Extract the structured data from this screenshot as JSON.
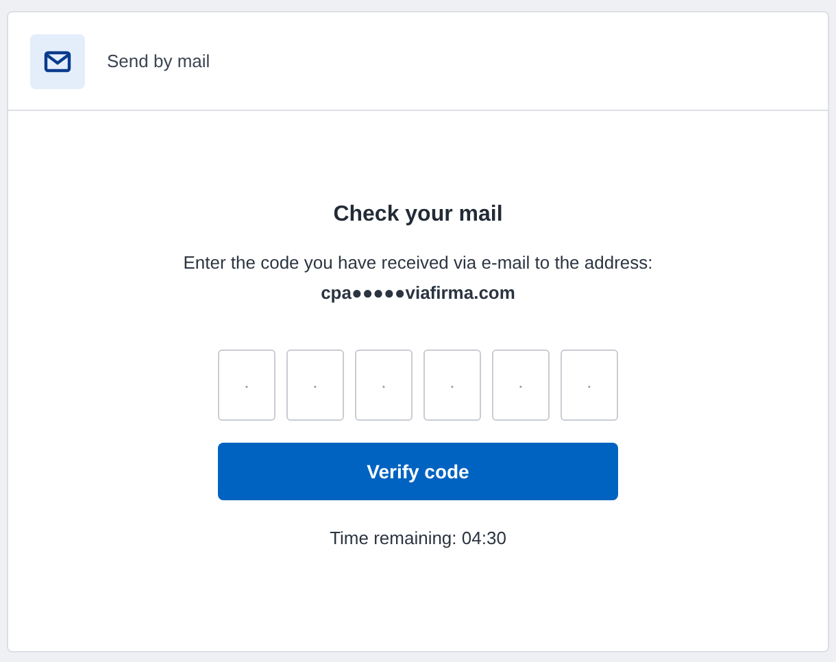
{
  "header": {
    "title": "Send by mail"
  },
  "heading": "Check your mail",
  "instruction": "Enter the code you have received via e-mail to the address:",
  "address": "cpa●●●●●viafirma.com",
  "code_inputs": [
    {
      "placeholder": "·"
    },
    {
      "placeholder": "·"
    },
    {
      "placeholder": "·"
    },
    {
      "placeholder": "·"
    },
    {
      "placeholder": "·"
    },
    {
      "placeholder": "·"
    }
  ],
  "button": "Verify code",
  "timer": "Time remaining: 04:30"
}
